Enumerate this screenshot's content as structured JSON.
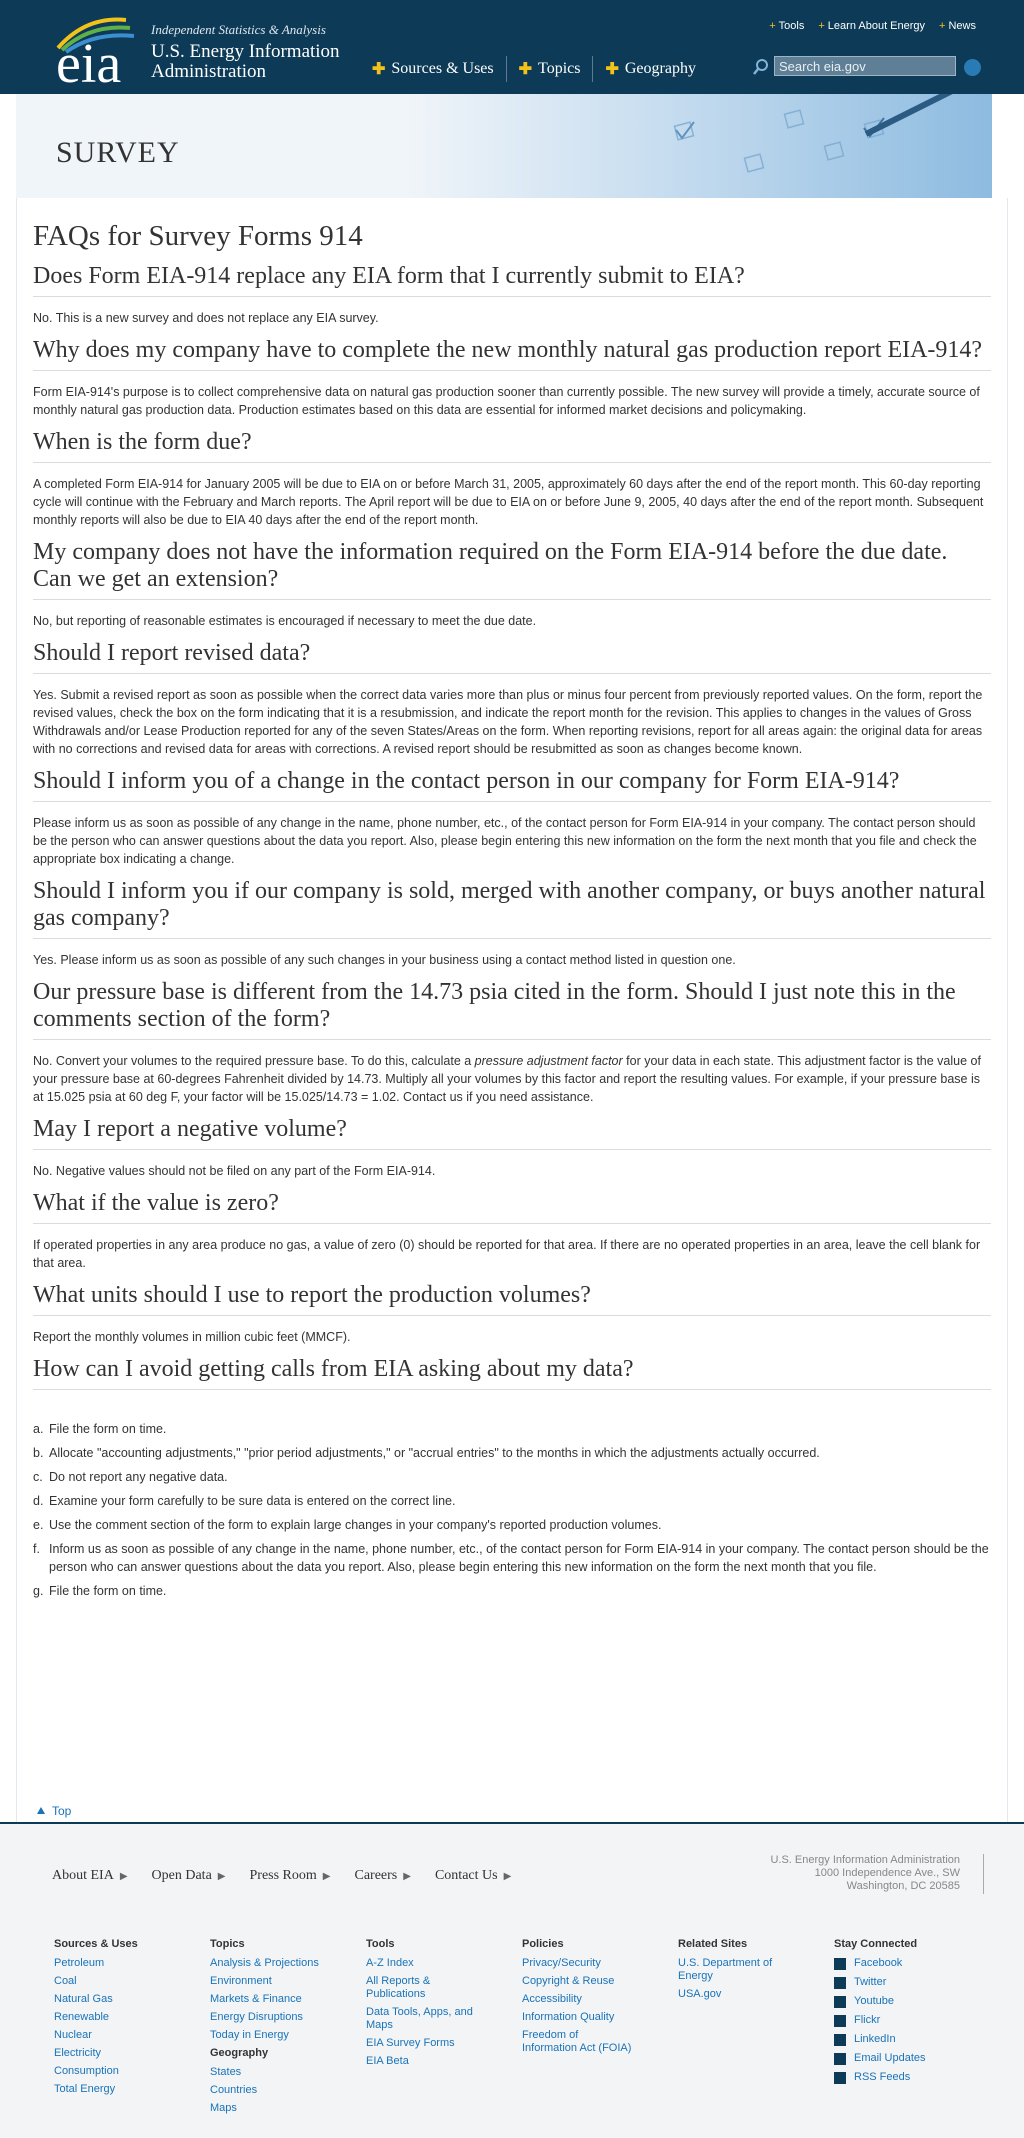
{
  "header": {
    "tagline": "Independent Statistics & Analysis",
    "org_line1": "U.S. Energy Information",
    "org_line2": "Administration",
    "logo_text": "eia",
    "nav": [
      "Sources & Uses",
      "Topics",
      "Geography"
    ],
    "util": [
      "Tools",
      "Learn About Energy",
      "News"
    ],
    "search_placeholder": "Search eia.gov"
  },
  "banner": {
    "title": "SURVEY"
  },
  "page": {
    "title": "FAQs for Survey Forms 914"
  },
  "faqs": [
    {
      "q": "Does Form EIA-914 replace any EIA form that I currently submit to EIA?",
      "a": "No. This is a new survey and does not replace any EIA survey."
    },
    {
      "q": "Why does my company have to complete the new monthly natural gas production report EIA-914?",
      "a": "Form EIA-914's purpose is to collect comprehensive data on natural gas production sooner than currently possible. The new survey will provide a timely, accurate source of monthly natural gas production data. Production estimates based on this data are essential for informed market decisions and policymaking."
    },
    {
      "q": "When is the form due?",
      "a": "A completed Form EIA-914 for January 2005 will be due to EIA on or before March 31, 2005, approximately 60 days after the end of the report month. This 60-day reporting cycle will continue with the February and March reports. The April report will be due to EIA on or before June 9, 2005, 40 days after the end of the report month. Subsequent monthly reports will also be due to EIA 40 days after the end of the report month."
    },
    {
      "q": "My company does not have the information required on the Form EIA-914 before the due date. Can we get an extension?",
      "a": "No, but reporting of reasonable estimates is encouraged if necessary to meet the due date."
    },
    {
      "q": "Should I report revised data?",
      "a": "Yes. Submit a revised report as soon as possible when the correct data varies more than plus or minus four percent from previously reported values. On the form, report the revised values, check the box on the form indicating that it is a resubmission, and indicate the report month for the revision. This applies to changes in the values of Gross Withdrawals and/or Lease Production reported for any of the seven States/Areas on the form. When reporting revisions, report for all areas again: the original data for areas with no corrections and revised data for areas with corrections. A revised report should be resubmitted as soon as changes become known."
    },
    {
      "q": "Should I inform you of a change in the contact person in our company for Form EIA-914?",
      "a": "Please inform us as soon as possible of any change in the name, phone number, etc., of the contact person for Form EIA-914 in your company. The contact person should be the person who can answer questions about the data you report. Also, please begin entering this new information on the form the next month that you file and check the appropriate box indicating a change."
    },
    {
      "q": "Should I inform you if our company is sold, merged with another company, or buys another natural gas company?",
      "a": "Yes. Please inform us as soon as possible of any such changes in your business using a contact method listed in question one."
    },
    {
      "q": "Our pressure base is different from the 14.73 psia cited in the form. Should I just note this in the comments section of the form?",
      "a_pre": "No. Convert your volumes to the required pressure base. To do this, calculate a ",
      "a_em": "pressure adjustment factor",
      "a_post": " for your data in each state. This adjustment factor is the value of your pressure base at 60-degrees Fahrenheit divided by 14.73. Multiply all your volumes by this factor and report the resulting values. For example, if your pressure base is at 15.025 psia at 60 deg F, your factor will be 15.025/14.73 = 1.02. Contact us if you need assistance."
    },
    {
      "q": "May I report a negative volume?",
      "a": "No. Negative values should not be filed on any part of the Form EIA-914."
    },
    {
      "q": "What if the value is zero?",
      "a": "If operated properties in any area produce no gas, a value of zero (0) should be reported for that area. If there are no operated properties in an area, leave the cell blank for that area."
    },
    {
      "q": "What units should I use to report the production volumes?",
      "a": "Report the monthly volumes in million cubic feet (MMCF)."
    },
    {
      "q": "How can I avoid getting calls from EIA asking about my data?"
    }
  ],
  "avoid_list": [
    {
      "l": "a.",
      "t": "File the form on time."
    },
    {
      "l": "b.",
      "t": "Allocate \"accounting adjustments,\" \"prior period adjustments,\" or \"accrual entries\" to the months in which the adjustments actually occurred."
    },
    {
      "l": "c.",
      "t": "Do not report any negative data."
    },
    {
      "l": "d.",
      "t": "Examine your form carefully to be sure data is entered on the correct line."
    },
    {
      "l": "e.",
      "t": "Use the comment section of the form to explain large changes in your company's reported production volumes."
    },
    {
      "l": "f.",
      "t": "Inform us as soon as possible of any change in the name, phone number, etc., of the contact person for Form EIA-914 in your company. The contact person should be the person who can answer questions about the data you report. Also, please begin entering this new information on the form the next month that you file."
    },
    {
      "l": "g.",
      "t": "File the form on time."
    }
  ],
  "top_link": "Top",
  "footer": {
    "nav": [
      "About EIA",
      "Open Data",
      "Press Room",
      "Careers",
      "Contact Us"
    ],
    "address": [
      "U.S. Energy Information Administration",
      "1000 Independence Ave., SW",
      "Washington, DC 20585"
    ],
    "cols": [
      {
        "h": "Sources & Uses",
        "links": [
          "Petroleum",
          "Coal",
          "Natural Gas",
          "Renewable",
          "Nuclear",
          "Electricity",
          "Consumption",
          "Total Energy"
        ]
      },
      {
        "h": "Topics",
        "links": [
          "Analysis & Projections",
          "Environment",
          "Markets & Finance",
          "Energy Disruptions",
          "Today in Energy"
        ],
        "h2": "Geography",
        "links2": [
          "States",
          "Countries",
          "Maps"
        ]
      },
      {
        "h": "Tools",
        "links": [
          "A-Z Index",
          "All Reports & Publications",
          "Data Tools, Apps, and Maps",
          "EIA Survey Forms",
          "EIA Beta"
        ]
      },
      {
        "h": "Policies",
        "links": [
          "Privacy/Security",
          "Copyright & Reuse",
          "Accessibility",
          "Information Quality",
          "Freedom of Information Act (FOIA)"
        ]
      },
      {
        "h": "Related Sites",
        "links": [
          "U.S. Department of Energy",
          "USA.gov"
        ]
      }
    ],
    "stay": {
      "h": "Stay Connected",
      "items": [
        "Facebook",
        "Twitter",
        "Youtube",
        "Flickr",
        "LinkedIn",
        "Email Updates",
        "RSS Feeds"
      ]
    }
  },
  "colors": {
    "header_bg": "#0c3a57",
    "accent_plus": "#f2c21b",
    "link": "#1a73b8"
  }
}
